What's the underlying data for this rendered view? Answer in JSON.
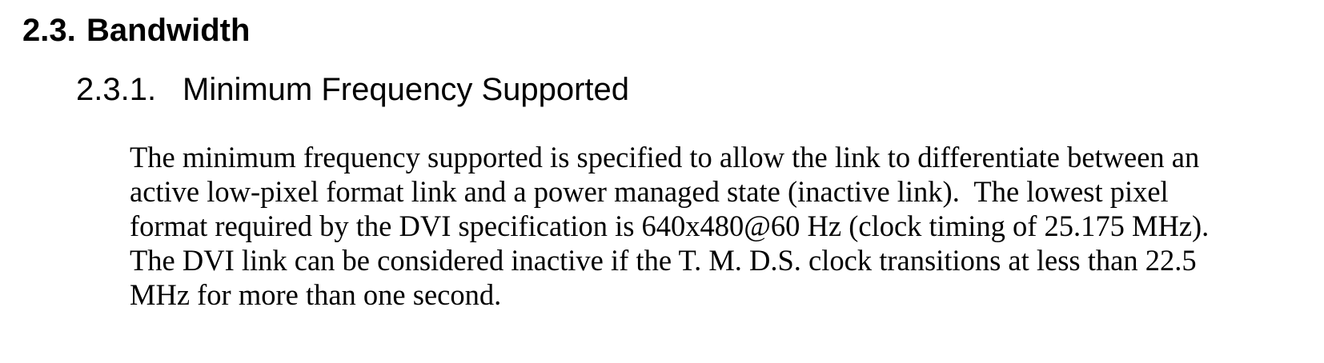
{
  "section": {
    "number": "2.3.",
    "title": "Bandwidth"
  },
  "subsection": {
    "number": "2.3.1.",
    "title": "Minimum Frequency Supported"
  },
  "paragraph": {
    "lines": [
      "The minimum frequency supported is specified to allow the link to differentiate between an",
      "active low-pixel format link and a power managed state (inactive link).  The lowest pixel",
      "format required by the DVI specification is 640x480@60 Hz (clock timing of 25.175 MHz).",
      "The DVI link can be considered inactive if the T. M. D.S. clock transitions at less than 22.5",
      "MHz for more than one second."
    ]
  }
}
